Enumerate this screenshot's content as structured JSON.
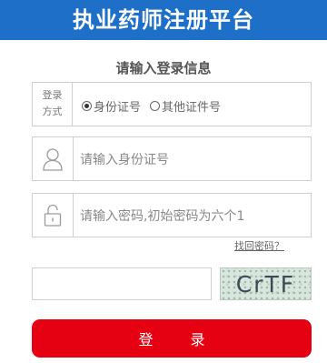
{
  "header": {
    "title": "执业药师注册平台"
  },
  "form": {
    "subtitle": "请输入登录信息",
    "login_type": {
      "label_line1": "登录",
      "label_line2": "方式",
      "options": [
        "身份证号",
        "其他证件号"
      ],
      "selected": "身份证号"
    },
    "id_field": {
      "placeholder": "请输入身份证号"
    },
    "password_field": {
      "placeholder": "请输入密码,初始密码为六个1"
    },
    "forgot_link": "找回密码？",
    "captcha": {
      "text": "CrTF"
    },
    "login_button": "登  录"
  },
  "colors": {
    "header_bg": "#1e6fc8",
    "button_bg": "#e50012"
  }
}
